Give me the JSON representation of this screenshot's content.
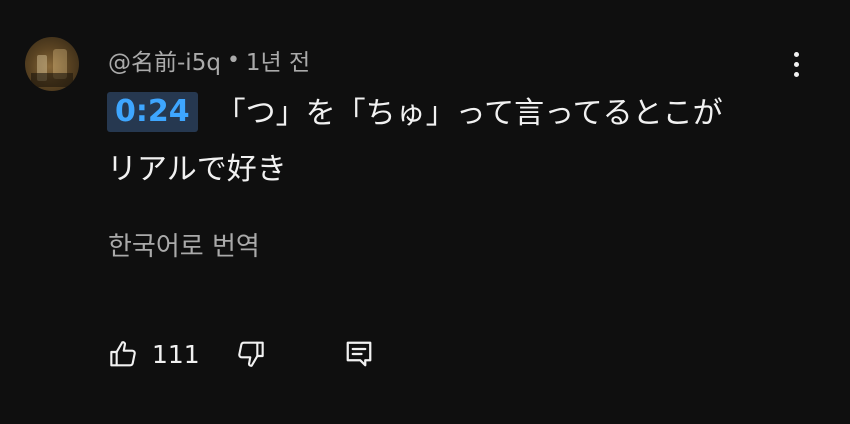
{
  "comment": {
    "author": "@名前-i5q",
    "separator": "•",
    "time_ago": "1년 전",
    "timestamp_link": "0:24",
    "text_line1": "「つ」を「ちゅ」って言ってるとこが",
    "text_line2": "リアルで好き",
    "translate_label": "한국어로 번역",
    "like_count": "111"
  },
  "icons": {
    "avatar": "user-avatar",
    "menu": "more-vert-icon",
    "like": "thumbs-up-icon",
    "dislike": "thumbs-down-icon",
    "reply": "reply-comment-icon"
  },
  "colors": {
    "background": "#0f0f0f",
    "primary_text": "#f1f1f1",
    "secondary_text": "#aaaaaa",
    "timestamp_link": "#3ea6ff",
    "timestamp_bg": "#263850"
  }
}
